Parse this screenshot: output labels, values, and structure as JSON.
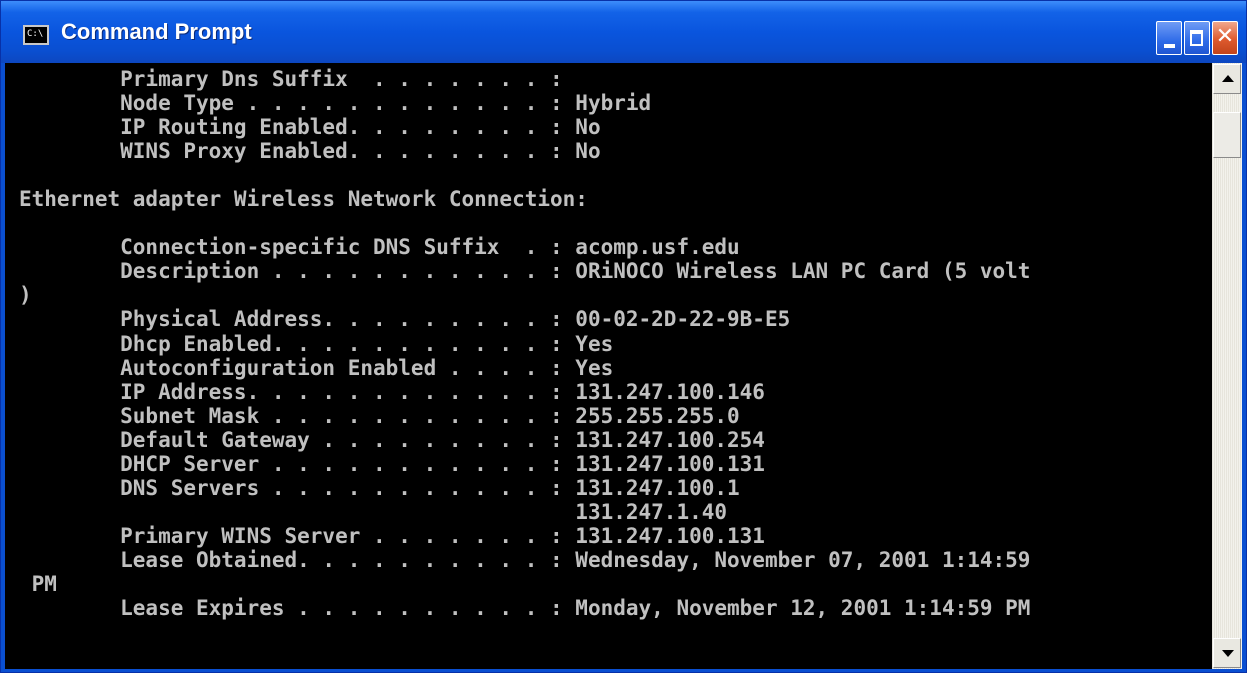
{
  "window": {
    "title": "Command Prompt",
    "icon_label": "C:\\",
    "controls": {
      "minimize": "minimize",
      "maximize": "maximize",
      "close": "close"
    }
  },
  "console": {
    "lines": [
      "        Primary Dns Suffix  . . . . . . . :",
      "        Node Type . . . . . . . . . . . . : Hybrid",
      "        IP Routing Enabled. . . . . . . . : No",
      "        WINS Proxy Enabled. . . . . . . . : No",
      "",
      "Ethernet adapter Wireless Network Connection:",
      "",
      "        Connection-specific DNS Suffix  . : acomp.usf.edu",
      "        Description . . . . . . . . . . . : ORiNOCO Wireless LAN PC Card (5 volt",
      ")",
      "        Physical Address. . . . . . . . . : 00-02-2D-22-9B-E5",
      "        Dhcp Enabled. . . . . . . . . . . : Yes",
      "        Autoconfiguration Enabled . . . . : Yes",
      "        IP Address. . . . . . . . . . . . : 131.247.100.146",
      "        Subnet Mask . . . . . . . . . . . : 255.255.255.0",
      "        Default Gateway . . . . . . . . . : 131.247.100.254",
      "        DHCP Server . . . . . . . . . . . : 131.247.100.131",
      "        DNS Servers . . . . . . . . . . . : 131.247.100.1",
      "                                            131.247.1.40",
      "        Primary WINS Server . . . . . . . : 131.247.100.131",
      "        Lease Obtained. . . . . . . . . . : Wednesday, November 07, 2001 1:14:59",
      " PM",
      "        Lease Expires . . . . . . . . . . : Monday, November 12, 2001 1:14:59 PM",
      ""
    ]
  },
  "colors": {
    "titlebar": "#0a4fd1",
    "console_bg": "#000000",
    "console_fg": "#c0c0c0"
  }
}
